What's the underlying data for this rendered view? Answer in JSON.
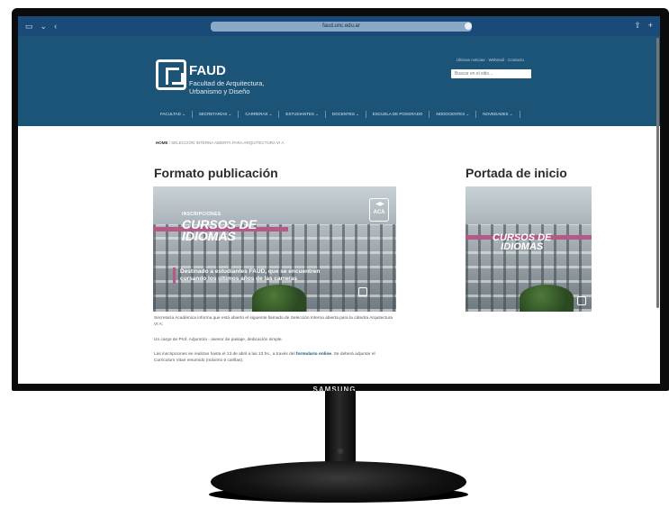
{
  "browser": {
    "url": "faud.unc.edu.ar"
  },
  "site": {
    "logo_title": "FAUD",
    "logo_sub1": "Facultad de Arquitectura,",
    "logo_sub2": "Urbanismo y Diseño",
    "toplinks": "Últimas noticias  ·  Webmail  ·  Contacto",
    "search_placeholder": "Buscar en el sitio...",
    "nav": [
      "FACULTAD ⌄",
      "SECRETARÍAS ⌄",
      "CARRERAS ⌄",
      "ESTUDIANTES ⌄",
      "DOCENTES ⌄",
      "ESCUELA DE POSGRADO",
      "NODOCENTES ⌄",
      "NOVEDADES ⌄"
    ]
  },
  "breadcrumb": {
    "home": "HOME",
    "current": "SELECCIÓN INTERNA ABIERTA PARA ARQUITECTURA VI A"
  },
  "main": {
    "left_heading": "Formato publicación",
    "right_heading": "Portada de inicio",
    "card1": {
      "kicker": "INSCRIPCIONES",
      "line1": "CURSOS DE",
      "line2": "IDIOMAS",
      "desc1": "Destinado a estudiantes FAUD, que se encuentren",
      "desc2": "cursando los últimos años de las carreras",
      "badge": "ACA"
    },
    "card2": {
      "line1": "CURSOS DE",
      "line2": "IDIOMAS"
    },
    "paragraphs": {
      "p1": "Secretaría Académica informa que está abierto el siguiente llamado de Selección Interna abierta para la cátedra Arquitectura VI A:",
      "p2": "Un cargo de Prof. Adjunto/a - asesor de paisaje, dedicación simple.",
      "p3a": "Las inscripciones se realizan hasta el 13 de abril a las 13 hs., a través del ",
      "p3link": "formulario online",
      "p3b": ". Se deberá adjuntar el Curriculum Vitae resumido (máximo 6 carillas)."
    }
  },
  "monitor": {
    "brand": "SAMSUNG"
  },
  "colors": {
    "header": "#1c5478",
    "accent": "#b35a86"
  }
}
